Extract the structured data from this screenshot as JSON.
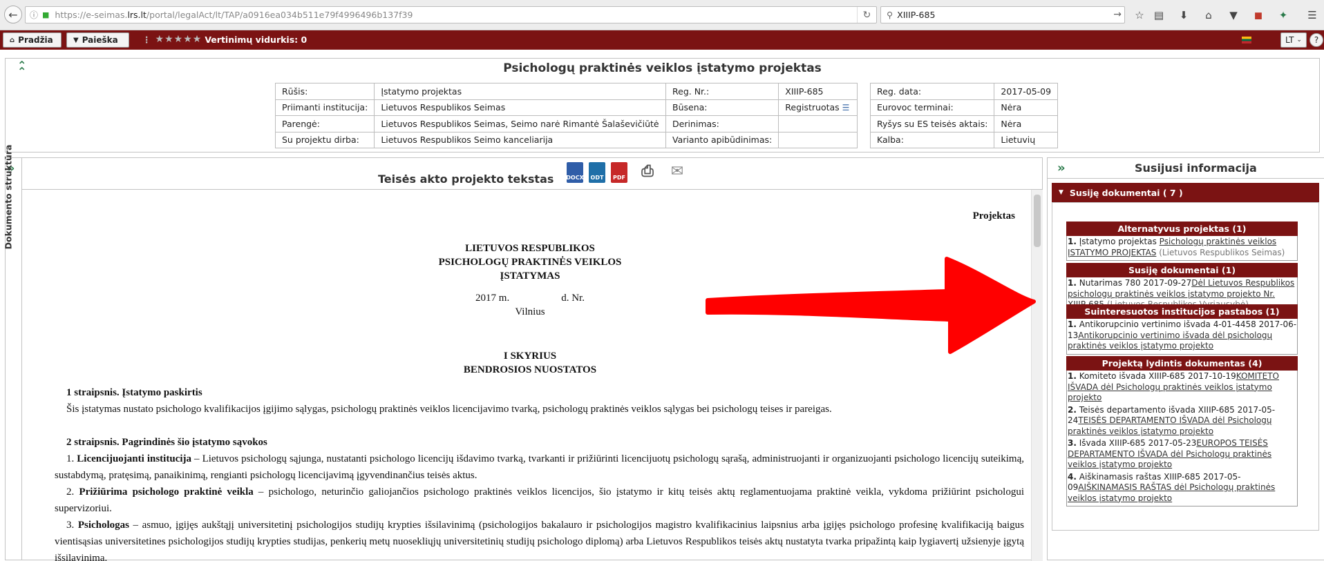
{
  "browser": {
    "url_prefix": "https://e-seimas.",
    "url_domain": "lrs.lt",
    "url_rest": "/portal/legalAct/lt/TAP/a0916ea034b511e79f4996496b137f39",
    "search_value": "XIIIP-685"
  },
  "appbar": {
    "home_label": "Pradžia",
    "search_label": "Paieška",
    "rating_label": "Vertinimų vidurkis: 0",
    "lang_label": "LT",
    "help_label": "?",
    "rating_stars": 5
  },
  "header": {
    "title": "Psichologų praktinės veiklos įstatymo projektas",
    "table1": [
      {
        "label": "Rūšis:",
        "value": "Įstatymo projektas"
      },
      {
        "label": "Priimanti institucija:",
        "value": "Lietuvos Respublikos Seimas"
      },
      {
        "label": "Parengė:",
        "value": "Lietuvos Respublikos Seimas, Seimo narė Rimantė Šalaševičiūtė"
      },
      {
        "label": "Su projektu dirba:",
        "value": "Lietuvos Respublikos Seimo kanceliarija"
      }
    ],
    "table2": [
      {
        "label": "Reg. Nr.:",
        "value": "XIIIP-685"
      },
      {
        "label": "Būsena:",
        "value": "Registruotas"
      },
      {
        "label": "Derinimas:",
        "value": ""
      },
      {
        "label": "Varianto apibūdinimas:",
        "value": ""
      }
    ],
    "table3": [
      {
        "label": "Reg. data:",
        "value": "2017-05-09"
      },
      {
        "label": "Eurovoc terminai:",
        "value": "Nėra"
      },
      {
        "label": "Ryšys su ES teisės aktais:",
        "value": "Nėra"
      },
      {
        "label": "Kalba:",
        "value": "Lietuvių"
      }
    ]
  },
  "sidebar": {
    "doc_structure_label": "Dokumento struktūra"
  },
  "document": {
    "heading": "Teisės akto projekto tekstas",
    "downloads": [
      "DOCX",
      "ODT",
      "PDF"
    ],
    "projektas": "Projektas",
    "republic": "LIETUVOS RESPUBLIKOS",
    "law_name_1": "PSICHOLOGŲ PRAKTINĖS VEIKLOS",
    "law_name_2": "ĮSTATYMAS",
    "date_line": "2017 m.                    d. Nr.",
    "city": "Vilnius",
    "chapter": "I SKYRIUS",
    "chapter_title": "BENDROSIOS NUOSTATOS",
    "art1_title": "1 straipsnis. Įstatymo paskirtis",
    "art1_text": "Šis įstatymas nustato psichologo kvalifikacijos įgijimo sąlygas, psichologų praktinės veiklos licencijavimo tvarką, psichologų praktinės veiklos sąlygas bei psichologų teises ir pareigas.",
    "art2_title": "2 straipsnis. Pagrindinės šio įstatymo sąvokos",
    "def1_num": "1. ",
    "def1_term": "Licencijuojanti institucija",
    "def1_text": " – Lietuvos psichologų sąjunga, nustatanti psichologo licencijų išdavimo tvarką, tvarkanti ir prižiūrinti licencijuotų psichologų sąrašą, administruojanti ir organizuojanti psichologo licencijų suteikimą, sustabdymą, pratęsimą, panaikinimą, rengianti psichologų licencijavimą įgyvendinančius teisės aktus.",
    "def2_num": "2. ",
    "def2_term": "Prižiūrima psichologo praktinė veikla",
    "def2_text": " – psichologo, neturinčio galiojančios psichologo praktinės veiklos licencijos, šio įstatymo ir kitų teisės aktų reglamentuojama praktinė veikla, vykdoma prižiūrint psichologui supervizoriui.",
    "def3_num": "3. ",
    "def3_term": "Psichologas",
    "def3_text": " – asmuo, įgijęs aukštąjį universitetinį psichologijos studijų krypties išsilavinimą (psichologijos bakalauro ir psichologijos magistro kvalifikacinius laipsnius arba įgijęs psichologo profesinę kvalifikaciją baigus vientisąsias universitetines psichologijos studijų krypties studijas, penkerių metų nuosekliųjų universitetinių studijų psichologo diplomą) arba Lietuvos Respublikos teisės aktų nustatyta tvarka pripažintą kaip lygiavertį užsienyje įgytą išsilavinimą."
  },
  "related": {
    "heading": "Susijusi informacija",
    "accordion": "Susiję dokumentai ( 7 )",
    "sections": [
      {
        "title": "Alternatyvus projektas (1)",
        "items": [
          {
            "num": "1.",
            "text": " Įstatymo projektas ",
            "link": "Psichologų praktinės veiklos ĮSTATYMO PROJEKTAS",
            "org": " (Lietuvos Respublikos Seimas)"
          }
        ]
      },
      {
        "title": "Susiję dokumentai (1)",
        "items": [
          {
            "num": "1.",
            "text": " Nutarimas 780 2017-09-27",
            "link": "Dėl Lietuvos Respublikos psichologų praktinės veiklos įstatymo projekto Nr. XIIIP-685",
            "org": " (Lietuvos Respublikos Vyriausybė)"
          }
        ]
      },
      {
        "title": "Suinteresuotos institucijos pastabos (1)",
        "items": [
          {
            "num": "1.",
            "text": " Antikorupcinio vertinimo išvada 4-01-4458 2017-06-13",
            "link": "Antikorupcinio vertinimo išvada dėl psichologų praktinės veiklos įstatymo projekto",
            "org": ""
          }
        ]
      },
      {
        "title": "Projektą lydintis dokumentas (4)",
        "items": [
          {
            "num": "1.",
            "text": " Komiteto išvada XIIIP-685 2017-10-19",
            "link": "KOMITETO IŠVADA dėl Psichologų praktinės veiklos įstatymo projekto",
            "org": ""
          },
          {
            "num": "2.",
            "text": " Teisės departamento išvada XIIIP-685 2017-05-24",
            "link": "TEISĖS DEPARTAMENTO IŠVADA dėl Psichologų praktinės veiklos įstatymo projekto",
            "org": ""
          },
          {
            "num": "3.",
            "text": " Išvada XIIIP-685 2017-05-23",
            "link": "EUROPOS TEISĖS DEPARTAMENTO IŠVADA dėl Psichologų praktinės veiklos įstatymo projekto",
            "org": ""
          },
          {
            "num": "4.",
            "text": " Aiškinamasis raštas XIIIP-685 2017-05-09",
            "link": "AIŠKINAMASIS RAŠTAS dėl Psichologų praktinės veiklos įstatymo projekto",
            "org": ""
          }
        ]
      }
    ]
  },
  "colors": {
    "brand": "#7b1313",
    "icon_green": "#2a7a4a",
    "annotation_arrow": "#ff0000"
  }
}
